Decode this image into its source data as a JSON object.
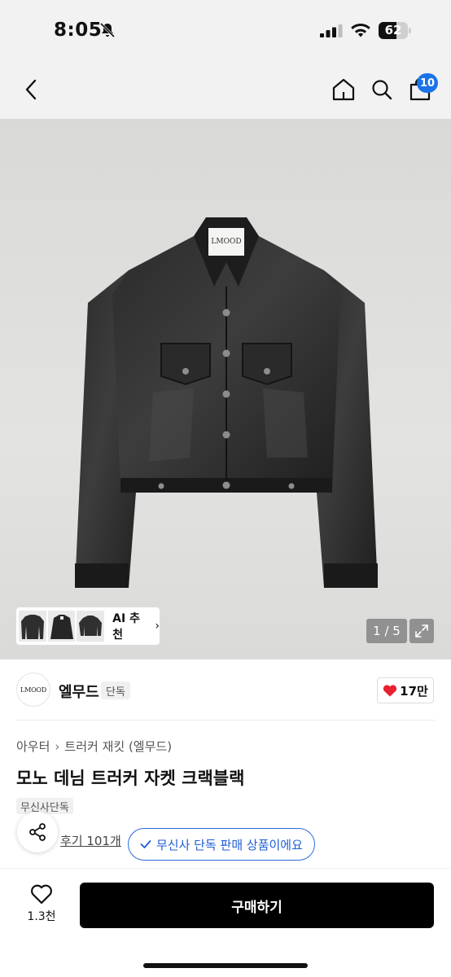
{
  "status_bar": {
    "time": "8:05",
    "battery": "62",
    "battery_level": 0.62
  },
  "nav": {
    "cart_badge": "10"
  },
  "gallery": {
    "ai_label": "AI 추천",
    "counter": "1 / 5",
    "thumbnails": [
      "jacket-front",
      "jacket-detail",
      "jacket-flat"
    ]
  },
  "brand": {
    "logo_text": "LMOOD",
    "name": "엘무드",
    "tag": "단독",
    "likes": "17만"
  },
  "product": {
    "breadcrumb": [
      "아우터",
      "트러커 재킷 (엘무드)"
    ],
    "title": "모노 데님 트러커 자켓 크랙블랙",
    "exclusive_tag": "무신사단독",
    "reviews": "후기 101개",
    "exclusive_notice": "무신사 단독 판매 상품이에요"
  },
  "bottom_bar": {
    "wish_count": "1.3천",
    "buy_label": "구매하기"
  },
  "colors": {
    "accent_blue": "#1a73e8",
    "like_red": "#e8202f",
    "buy_button": "#000000"
  }
}
